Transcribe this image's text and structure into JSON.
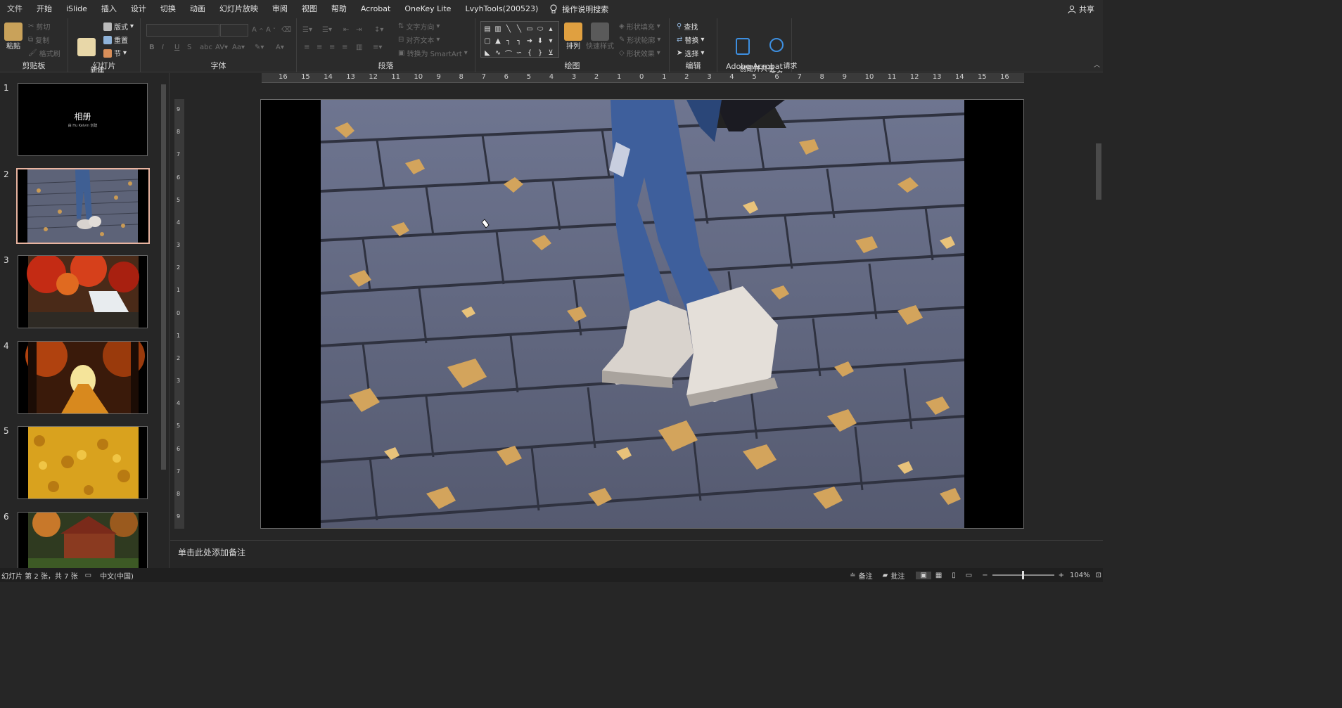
{
  "menubar": {
    "tabs": [
      "文件",
      "开始",
      "iSlide",
      "插入",
      "设计",
      "切换",
      "动画",
      "幻灯片放映",
      "审阅",
      "视图",
      "帮助",
      "Acrobat",
      "OneKey Lite",
      "LvyhTools(200523)"
    ],
    "tell_me": "操作说明搜索",
    "share": "共享"
  },
  "ribbon": {
    "clipboard": {
      "label": "剪贴板",
      "paste": "粘贴",
      "cut": "剪切",
      "copy": "复制",
      "format_painter": "格式刷"
    },
    "slides": {
      "label": "幻灯片",
      "new_slide": "新建\n幻灯片",
      "layout": "版式",
      "reset": "重置",
      "section": "节"
    },
    "font": {
      "label": "字体",
      "bold": "B",
      "italic": "I",
      "underline": "U",
      "strike": "S"
    },
    "paragraph": {
      "label": "段落",
      "text_direction": "文字方向",
      "align_text": "对齐文本",
      "convert_smartart": "转换为 SmartArt"
    },
    "drawing": {
      "label": "绘图",
      "arrange": "排列",
      "quick_styles": "快速样式",
      "shape_fill": "形状填充",
      "shape_outline": "形状轮廓",
      "shape_effects": "形状效果"
    },
    "editing": {
      "label": "编辑",
      "find": "查找",
      "replace": "替换",
      "select": "选择"
    },
    "acrobat": {
      "label": "Adobe Acrobat",
      "create_share": "创建并共享\nAdobe PDF",
      "request_sign": "请求\n签名"
    }
  },
  "thumbnails": [
    {
      "num": "1",
      "title": "相册",
      "subtitle": "由 Hu Kelvin 创建"
    },
    {
      "num": "2"
    },
    {
      "num": "3"
    },
    {
      "num": "4"
    },
    {
      "num": "5"
    },
    {
      "num": "6"
    }
  ],
  "hruler_ticks": [
    "16",
    "15",
    "14",
    "13",
    "12",
    "11",
    "10",
    "9",
    "8",
    "7",
    "6",
    "5",
    "4",
    "3",
    "2",
    "1",
    "0",
    "1",
    "2",
    "3",
    "4",
    "5",
    "6",
    "7",
    "8",
    "9",
    "10",
    "11",
    "12",
    "13",
    "14",
    "15",
    "16"
  ],
  "vruler_ticks": [
    "9",
    "8",
    "7",
    "6",
    "5",
    "4",
    "3",
    "2",
    "1",
    "0",
    "1",
    "2",
    "3",
    "4",
    "5",
    "6",
    "7",
    "8",
    "9"
  ],
  "notes": {
    "placeholder": "单击此处添加备注"
  },
  "status": {
    "slide_info": "幻灯片 第 2 张，共 7 张",
    "language": "中文(中国)",
    "notes": "备注",
    "comments": "批注",
    "zoom": "104%"
  },
  "colors": {
    "accent_selected": "#e8b4a0",
    "background": "#262626"
  }
}
